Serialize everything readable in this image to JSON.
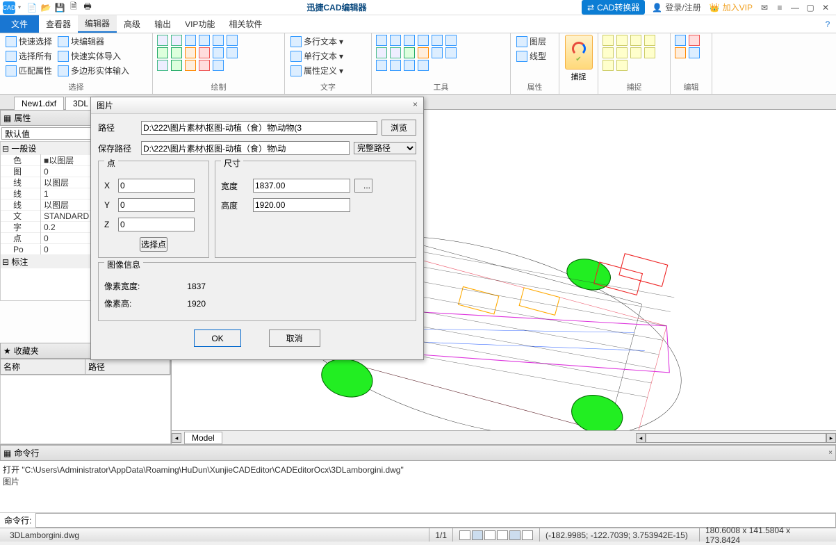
{
  "title": "迅捷CAD编辑器",
  "titlebar": {
    "logo": "CAD",
    "cad_convert": "CAD转换器",
    "login": "登录/注册",
    "vip": "加入VIP"
  },
  "menu": {
    "file": "文件",
    "tabs": [
      "查看器",
      "编辑器",
      "高级",
      "输出",
      "VIP功能",
      "相关软件"
    ],
    "active_idx": 1
  },
  "ribbon": {
    "select": {
      "quick": "快速选择",
      "all": "选择所有",
      "match": "匹配属性",
      "block": "块编辑器",
      "solid": "快速实体导入",
      "poly": "多边形实体输入",
      "grp": "选择"
    },
    "draw": {
      "grp": "绘制"
    },
    "text": {
      "mtext": "多行文本",
      "stext": "单行文本",
      "propdef": "属性定义",
      "grp": "文字"
    },
    "tool": {
      "grp": "工具"
    },
    "layer": {
      "layer": "图层",
      "ltype": "线型",
      "grp": "属性"
    },
    "snap": {
      "btn": "捕捉",
      "grp": "捕捉"
    },
    "edit": {
      "grp": "编辑"
    }
  },
  "filetabs": [
    "New1.dxf",
    "3DL"
  ],
  "props": {
    "title": "属性",
    "combo": "默认值",
    "g1": "一般设",
    "rows": [
      {
        "k": "色",
        "v": "■以图层"
      },
      {
        "k": "图",
        "v": "0"
      },
      {
        "k": "线",
        "v": "以图层"
      },
      {
        "k": "线",
        "v": "1"
      },
      {
        "k": "线",
        "v": "以图层"
      },
      {
        "k": "文",
        "v": "STANDARD"
      },
      {
        "k": "字",
        "v": "0.2"
      },
      {
        "k": "点",
        "v": "0"
      },
      {
        "k": "Po",
        "v": "0"
      }
    ],
    "g2": "标注"
  },
  "fav": {
    "title": "收藏夹",
    "col1": "名称",
    "col2": "路径"
  },
  "model_tab": "Model",
  "cmd": {
    "title": "命令行",
    "log1": "打开 \"C:\\Users\\Administrator\\AppData\\Roaming\\HuDun\\XunjieCADEditor\\CADEditorOcx\\3DLamborgini.dwg\"",
    "log2": "图片",
    "label": "命令行:"
  },
  "status": {
    "file": "3DLamborgini.dwg",
    "pages": "1/1",
    "coords": "(-182.9985; -122.7039; 3.753942E-15)",
    "dims": "180.6008 x 141.5804 x 173.8424"
  },
  "dialog": {
    "title": "图片",
    "path_lbl": "路径",
    "path_val": "D:\\222\\图片素材\\抠图-动植（食）物\\动物(3",
    "browse": "浏览",
    "save_lbl": "保存路径",
    "save_val": "D:\\222\\图片素材\\抠图-动植（食）物\\动",
    "path_mode": "完整路径",
    "point": "点",
    "x": "X",
    "y": "Y",
    "z": "Z",
    "xv": "0",
    "yv": "0",
    "zv": "0",
    "pick": "选择点",
    "size": "尺寸",
    "w": "宽度",
    "h": "高度",
    "wv": "1837.00",
    "hv": "1920.00",
    "dots": "...",
    "imginfo": "图像信息",
    "pxw_lbl": "像素宽度:",
    "pxh_lbl": "像素高:",
    "pxw": "1837",
    "pxh": "1920",
    "ok": "OK",
    "cancel": "取消"
  }
}
